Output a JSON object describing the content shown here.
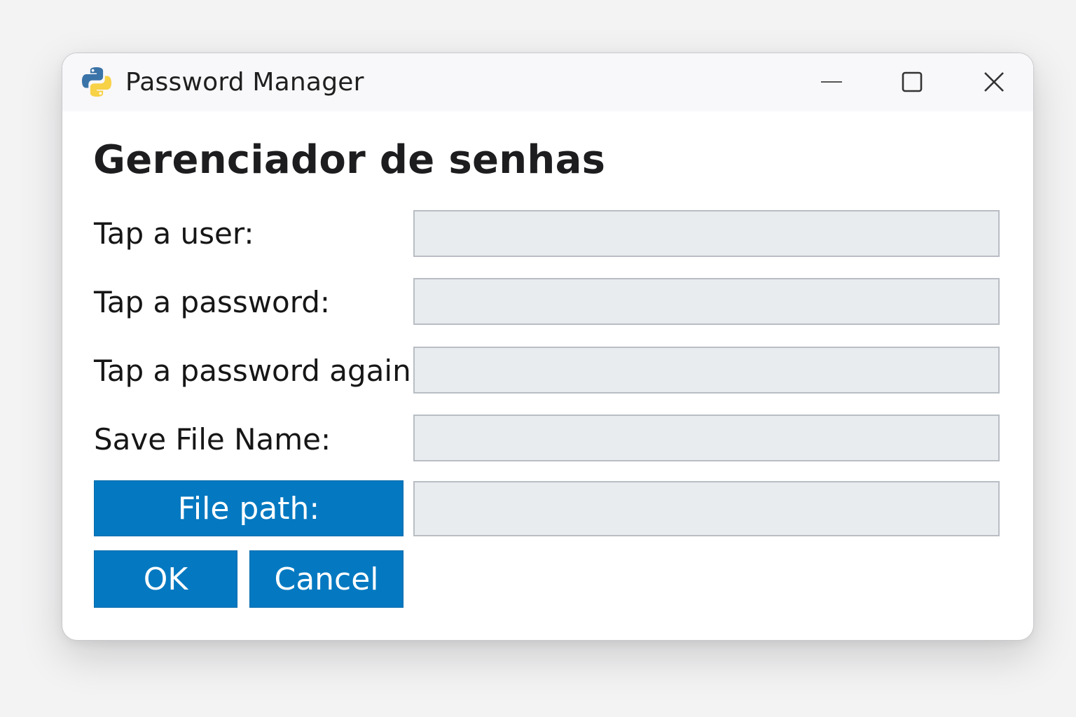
{
  "window": {
    "title": "Password Manager",
    "app_icon": "python-logo-icon",
    "controls": {
      "minimize": "minimize-icon",
      "maximize": "maximize-icon",
      "close": "close-icon"
    }
  },
  "form": {
    "heading": "Gerenciador de senhas",
    "user_label": "Tap a user:",
    "user_value": "",
    "password_label": "Tap a password:",
    "password_value": "",
    "password_again_label": "Tap a password again:",
    "password_again_value": "",
    "save_file_label": "Save File Name:",
    "save_file_value": "",
    "file_path_button": "File path:",
    "file_path_value": ""
  },
  "actions": {
    "ok_label": "OK",
    "cancel_label": "Cancel"
  },
  "colors": {
    "accent": "#0479c1",
    "field_background": "#e8ecef",
    "field_border": "#b9bec4",
    "python_blue": "#3a73a8",
    "python_yellow": "#f7d146"
  }
}
